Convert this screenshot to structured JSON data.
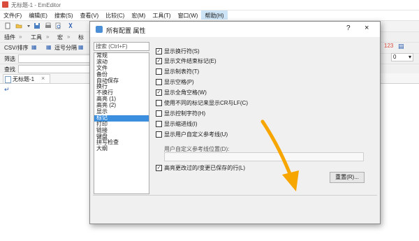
{
  "window": {
    "title": "无标题-1 - EmEditor"
  },
  "menubar": {
    "items": [
      "文件(F)",
      "编辑(E)",
      "搜索(S)",
      "查看(V)",
      "比较(C)",
      "宏(M)",
      "工具(T)",
      "窗口(W)",
      "帮助(H)"
    ],
    "active_index": 8
  },
  "toolbar2": {
    "items": [
      "插件",
      "工具",
      "宏",
      "标"
    ]
  },
  "toolbar3": {
    "csv_label": "CSV/排序",
    "delim_label": "逗号分隔"
  },
  "find_row": {
    "label": "筛选"
  },
  "search_row": {
    "label": "查找"
  },
  "right_controls": {
    "combo_value": "0"
  },
  "tab": {
    "label": "无标题-1",
    "close": "×"
  },
  "editor": {
    "caret": "↵"
  },
  "dialog": {
    "title": "所有配置 属性",
    "help": "?",
    "close": "×",
    "search_placeholder": "搜索 (Ctrl+F)",
    "categories": [
      "常规",
      "滚动",
      "文件",
      "备份",
      "自动保存",
      "换行",
      "不换行",
      "高亮 (1)",
      "高亮 (2)",
      "显示",
      "标记",
      "打印",
      "链接",
      "键盘",
      "拼写检查",
      "大纲"
    ],
    "selected_category_index": 10,
    "options": [
      {
        "label": "显示换行符(S)",
        "checked": true
      },
      {
        "label": "显示文件结束标记(E)",
        "checked": true
      },
      {
        "label": "显示制表符(T)",
        "checked": false
      },
      {
        "label": "显示空格(P)",
        "checked": false
      },
      {
        "label": "显示全角空格(W)",
        "checked": true
      },
      {
        "label": "使用不同的标记来显示CR与LF(C)",
        "checked": false
      },
      {
        "label": "显示控制字符(H)",
        "checked": false
      },
      {
        "label": "显示缩进线(I)",
        "checked": false
      },
      {
        "label": "显示用户自定义参考线(U)",
        "checked": false
      }
    ],
    "custom_guide_label": "用户自定义参考线位置(D):",
    "highlight_option": {
      "label": "高亮更改过的/变更已保存的行(L)",
      "checked": true
    },
    "reset_button": "重置(R)..."
  },
  "colors": {
    "accent": "#3b8fde",
    "arrow": "#f7a600"
  }
}
